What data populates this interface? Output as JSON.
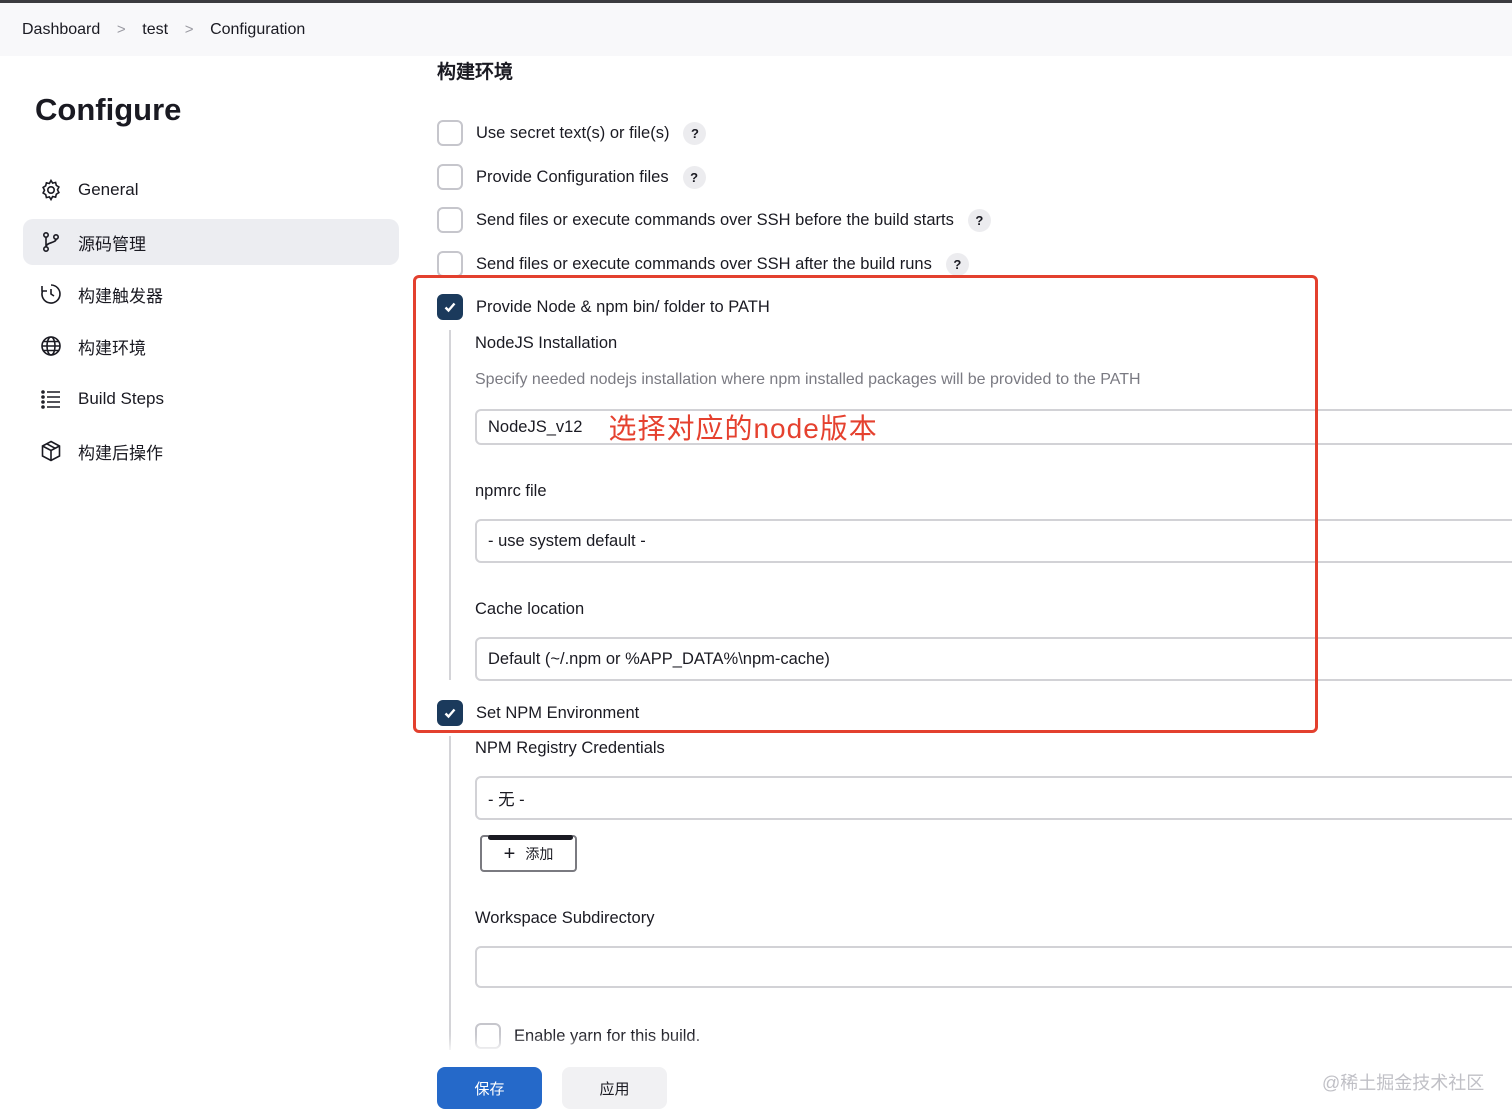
{
  "breadcrumb": {
    "items": [
      "Dashboard",
      "test",
      "Configuration"
    ],
    "separator": ">"
  },
  "sidebar": {
    "title": "Configure",
    "items": [
      {
        "label": "General",
        "icon": "gear-icon"
      },
      {
        "label": "源码管理",
        "icon": "branch-icon",
        "active": true
      },
      {
        "label": "构建触发器",
        "icon": "clock-icon"
      },
      {
        "label": "构建环境",
        "icon": "globe-icon"
      },
      {
        "label": "Build Steps",
        "icon": "list-icon"
      },
      {
        "label": "构建后操作",
        "icon": "cube-icon"
      }
    ]
  },
  "main": {
    "section_title": "构建环境",
    "help_glyph": "?",
    "options": [
      {
        "label": "Use secret text(s) or file(s)",
        "checked": false
      },
      {
        "label": "Provide Configuration files",
        "checked": false
      },
      {
        "label": "Send files or execute commands over SSH before the build starts",
        "checked": false
      },
      {
        "label": "Send files or execute commands over SSH after the build runs",
        "checked": false
      },
      {
        "label": "Provide Node & npm bin/ folder to PATH",
        "checked": true
      }
    ],
    "nodejs": {
      "installation_label": "NodeJS Installation",
      "installation_desc": "Specify needed nodejs installation where npm installed packages will be provided to the PATH",
      "installation_value": "NodeJS_v12",
      "annotation": "选择对应的node版本",
      "npmrc_label": "npmrc file",
      "npmrc_value": "- use system default -",
      "cache_label": "Cache location",
      "cache_value": "Default (~/.npm or %APP_DATA%\\npm-cache)"
    },
    "set_npm_env": {
      "label": "Set NPM Environment",
      "checked": true
    },
    "registry": {
      "label": "NPM Registry Credentials",
      "value": "- 无 -",
      "add_label": "添加",
      "add_glyph": "+"
    },
    "workspace": {
      "label": "Workspace Subdirectory",
      "value": ""
    },
    "yarn": {
      "label": "Enable yarn for this build.",
      "checked": false
    }
  },
  "footer": {
    "save_label": "保存",
    "apply_label": "应用",
    "watermark": "@稀土掘金技术社区"
  },
  "colors": {
    "primary": "#2569c9",
    "checkbox_checked": "#1b3a5c",
    "annotation": "#e5412f",
    "active_sidebar": "#ecedf1"
  }
}
